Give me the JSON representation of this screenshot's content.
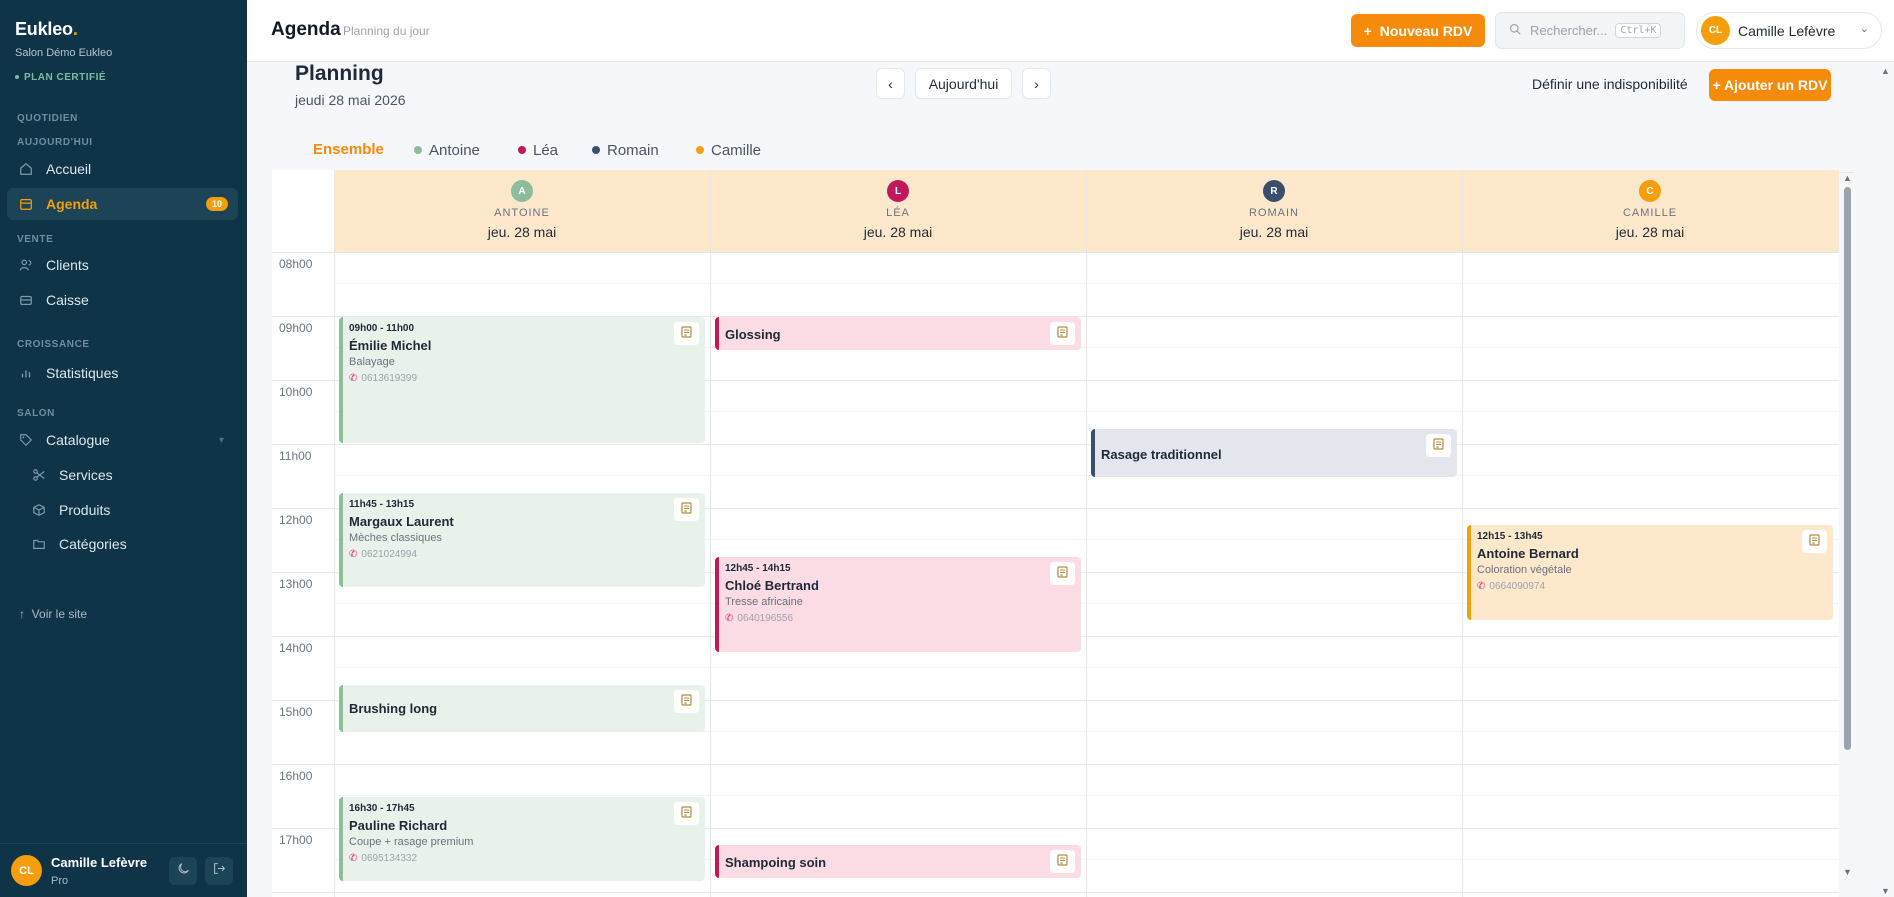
{
  "sidebar": {
    "brand": "Eukleo",
    "brand_dot": ".",
    "salon": "Salon Démo Eukleo",
    "plan": "PLAN CERTIFIÉ",
    "sections": {
      "quotidien": "QUOTIDIEN",
      "aujourdhui": "AUJOURD'HUI",
      "vente": "VENTE",
      "croissance": "CROISSANCE",
      "salon": "SALON"
    },
    "items": {
      "accueil": "Accueil",
      "agenda": "Agenda",
      "agenda_count": "10",
      "clients": "Clients",
      "caisse": "Caisse",
      "statistiques": "Statistiques",
      "catalogue": "Catalogue",
      "services": "Services",
      "produits": "Produits",
      "categories": "Catégories"
    },
    "voir_site": "Voir le site",
    "user": {
      "initials": "CL",
      "name": "Camille Lefèvre",
      "role": "Pro"
    }
  },
  "topbar": {
    "title": "Agenda",
    "subtitle": "Planning du jour",
    "new_rdv": "Nouveau RDV",
    "search_placeholder": "Rechercher...",
    "search_shortcut": "Ctrl+K",
    "user_initials": "CL",
    "user_name": "Camille Lefèvre"
  },
  "planning": {
    "title": "Planning",
    "date": "jeudi 28 mai 2026",
    "today": "Aujourd'hui",
    "define_unavailability": "Définir une indisponibilité",
    "add_rdv": "+ Ajouter un RDV",
    "tabs": [
      {
        "label": "Ensemble"
      },
      {
        "label": "Antoine",
        "color": "#8dbd9b"
      },
      {
        "label": "Léa",
        "color": "#c0185a"
      },
      {
        "label": "Romain",
        "color": "#3a4f6e"
      },
      {
        "label": "Camille",
        "color": "#f59e0b"
      }
    ]
  },
  "calendar": {
    "hours": [
      "08h00",
      "09h00",
      "10h00",
      "11h00",
      "12h00",
      "13h00",
      "14h00",
      "15h00",
      "16h00",
      "17h00"
    ],
    "columns": [
      {
        "initial": "A",
        "name": "ANTOINE",
        "date": "jeu. 28 mai",
        "color": "#8dbd9b"
      },
      {
        "initial": "L",
        "name": "LÉA",
        "date": "jeu. 28 mai",
        "color": "#c0185a"
      },
      {
        "initial": "R",
        "name": "ROMAIN",
        "date": "jeu. 28 mai",
        "color": "#3a4f6e"
      },
      {
        "initial": "C",
        "name": "CAMILLE",
        "date": "jeu. 28 mai",
        "color": "#f59e0b"
      }
    ],
    "events": [
      {
        "time": "09h00 - 11h00",
        "client": "Émilie Michel",
        "service": "Balayage",
        "phone": "0613619399"
      },
      {
        "time": "11h45 - 13h15",
        "client": "Margaux Laurent",
        "service": "Mèches classiques",
        "phone": "0621024994"
      },
      {
        "title": "Brushing long"
      },
      {
        "time": "16h30 - 17h45",
        "client": "Pauline Richard",
        "service": "Coupe + rasage premium",
        "phone": "0695134332"
      },
      {
        "title": "Glossing"
      },
      {
        "time": "12h45 - 14h15",
        "client": "Chloé Bertrand",
        "service": "Tresse africaine",
        "phone": "0640196556"
      },
      {
        "title": "Shampoing soin"
      },
      {
        "title": "Rasage traditionnel"
      },
      {
        "time": "12h15 - 13h45",
        "client": "Antoine Bernard",
        "service": "Coloration végétale",
        "phone": "0664090974"
      }
    ]
  }
}
